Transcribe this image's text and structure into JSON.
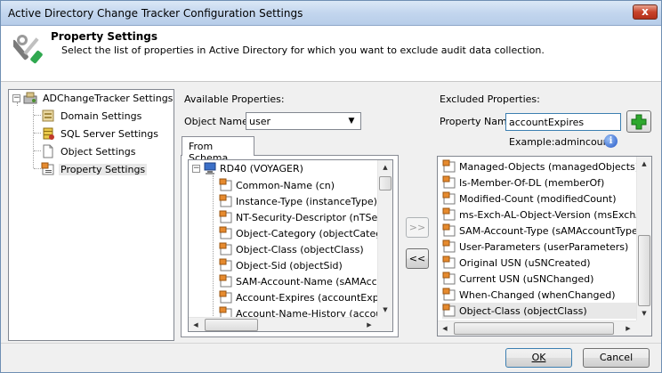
{
  "window": {
    "title": "Active Directory Change Tracker Configuration Settings",
    "close_glyph": "x"
  },
  "header": {
    "title": "Property Settings",
    "description": "Select the list of properties in Active Directory for which you want to exclude audit data collection."
  },
  "tree": {
    "root_label": "ADChangeTracker Settings",
    "root_expander": "−",
    "items": [
      {
        "label": "Domain Settings",
        "icon": "domain-settings-icon"
      },
      {
        "label": "SQL Server Settings",
        "icon": "database-icon"
      },
      {
        "label": "Object Settings",
        "icon": "document-icon"
      },
      {
        "label": "Property Settings",
        "icon": "property-icon",
        "selected": true
      }
    ]
  },
  "available": {
    "heading": "Available Properties:",
    "object_name_label": "Object Name:",
    "object_name_value": "user",
    "tab_label": "From Schema",
    "root_label": "RD40 (VOYAGER)",
    "root_expander": "−",
    "items": [
      "Common-Name (cn)",
      "Instance-Type (instanceType)",
      "NT-Security-Descriptor (nTSecur",
      "Object-Category (objectCategory",
      "Object-Class (objectClass)",
      "Object-Sid (objectSid)",
      "SAM-Account-Name (sAMAccou",
      "Account-Expires (accountExpires",
      "Account-Name-History (accountN"
    ]
  },
  "transfer": {
    "add_label": ">>",
    "remove_label": "<<"
  },
  "excluded": {
    "heading": "Excluded Properties:",
    "property_name_label": "Property Name:",
    "property_name_value": "accountExpires",
    "example_text": "Example:admincount",
    "add_glyph": "+",
    "info_glyph": "i",
    "items": [
      "Managed-Objects (managedObjects)",
      "Is-Member-Of-DL (memberOf)",
      "Modified-Count (modifiedCount)",
      "ms-Exch-AL-Object-Version (msExchALObj",
      "SAM-Account-Type (sAMAccountType)",
      "User-Parameters (userParameters)",
      "Original USN (uSNCreated)",
      "Current USN (uSNChanged)",
      "When-Changed (whenChanged)",
      "Object-Class (objectClass)"
    ]
  },
  "footer": {
    "ok_label": "OK",
    "cancel_label": "Cancel"
  },
  "colors": {
    "accent": "#3c7fb1",
    "add_green": "#2ea82e"
  }
}
